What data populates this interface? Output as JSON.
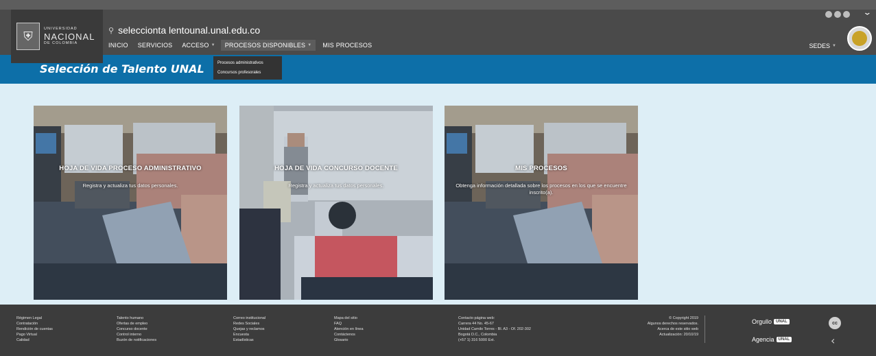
{
  "header": {
    "logo": {
      "line1": "UNIVERSIDAD",
      "line2": "NACIONAL",
      "line3": "DE COLOMBIA",
      "icon": "shield-icon"
    },
    "site_url": "seleccionta lentounal.unal.edu.co",
    "nav": [
      {
        "label": "INICIO",
        "has_caret": false
      },
      {
        "label": "SERVICIOS",
        "has_caret": false
      },
      {
        "label": "ACCESO",
        "has_caret": true
      },
      {
        "label": "PROCESOS DISPONIBLES",
        "has_caret": true,
        "active": true
      },
      {
        "label": "MIS PROCESOS",
        "has_caret": false
      }
    ],
    "dropdown": [
      "Procesos administrativos",
      "Concursos profesorales"
    ],
    "sedes_label": "SEDES"
  },
  "title_bar": {
    "title": "Selección de Talento UNAL",
    "color": "#0d6fa8"
  },
  "cards": [
    {
      "title": "HOJA DE VIDA PROCESO ADMINISTRATIVO",
      "description": "Registra y actualiza tus datos personales."
    },
    {
      "title": "HOJA DE VIDA CONCURSO DOCENTE",
      "description": "Registra y actualiza tus datos personales."
    },
    {
      "title": "MIS PROCESOS",
      "description": "Obtenga información detallada sobre los procesos en los que se encuentre inscrito(a)."
    }
  ],
  "footer": {
    "col1": [
      "Régimen Legal",
      "Contratación",
      "Rendición de cuentas",
      "Pago Virtual",
      "Calidad"
    ],
    "col2": [
      "Talento humano",
      "Ofertas de empleo",
      "Concurso docente",
      "Control interno",
      "Buzón de notificaciones"
    ],
    "col3": [
      "Correo institucional",
      "Redes Sociales",
      "Quejas y reclamos",
      "Encuesta",
      "Estadísticas"
    ],
    "col4": [
      "Mapa del sitio",
      "FAQ",
      "Atención en línea",
      "Contáctenos",
      "Glosario"
    ],
    "col5": [
      "Contacto página web:",
      "Carrera 44 No. 45-67",
      "Unidad Camilo Torres - Bl. A3 - Of. 202-302",
      "Bogotá D.C., Colombia",
      "(+57 1) 316 5000 Ext."
    ],
    "col6": [
      "© Copyright 2019",
      "Algunos derechos reservados.",
      "Acerca de este sitio web",
      "Actualización: 20/10/19"
    ],
    "brand1": "Orgullo",
    "brand2": "Agencia",
    "badge": "UNAL",
    "cc_label": "cc"
  }
}
